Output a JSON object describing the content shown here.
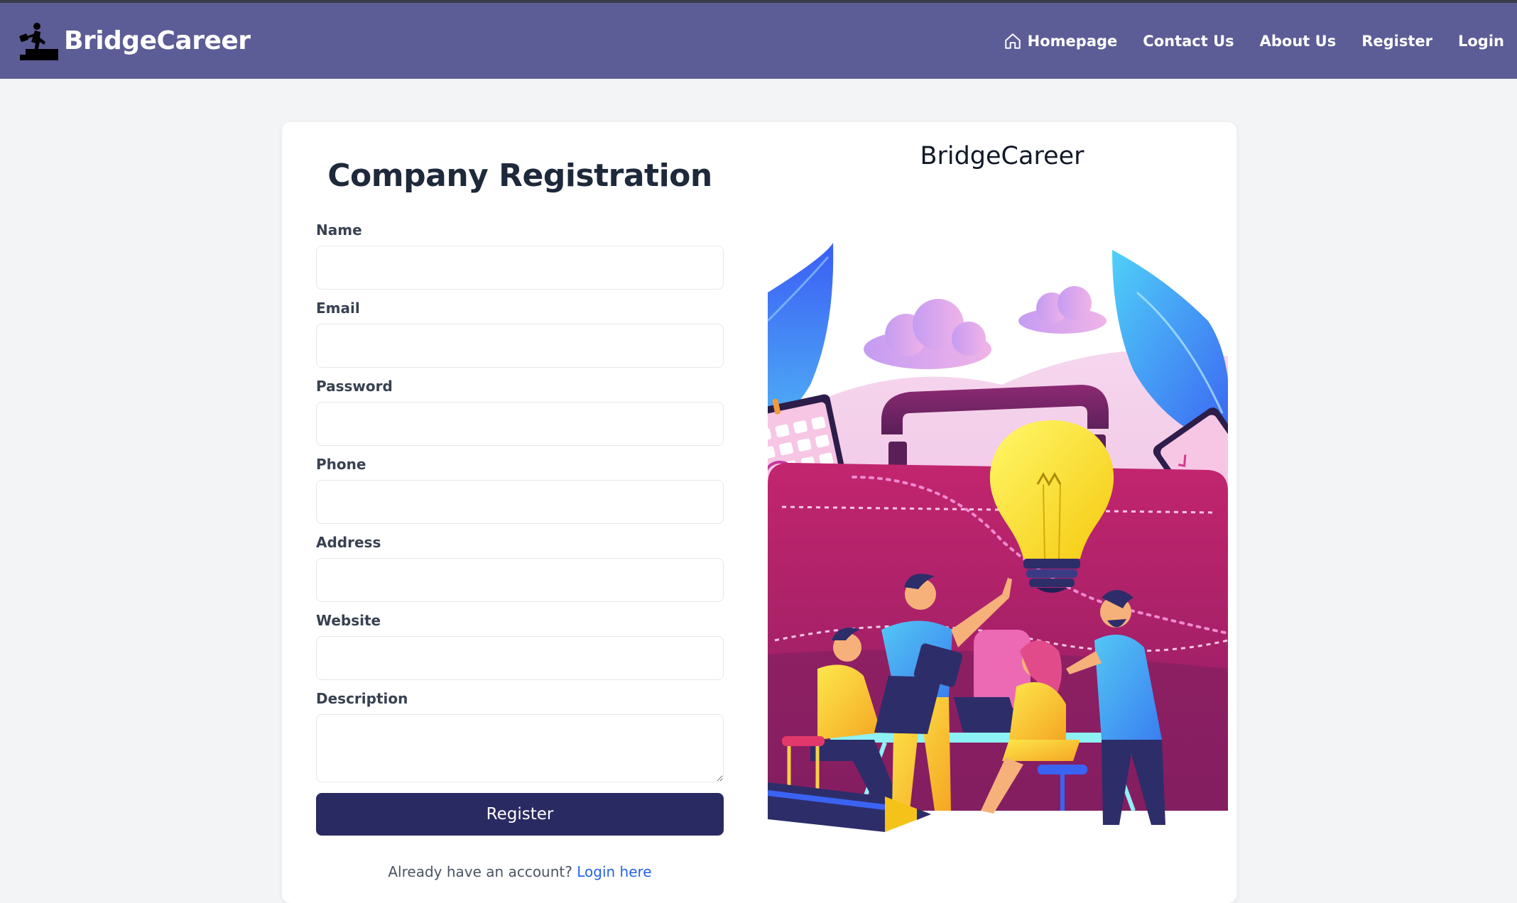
{
  "navbar": {
    "brand": "BridgeCareer",
    "links": [
      {
        "label": "Homepage",
        "icon": "home-icon"
      },
      {
        "label": "Contact Us"
      },
      {
        "label": "About Us"
      },
      {
        "label": "Register"
      },
      {
        "label": "Login"
      }
    ]
  },
  "form": {
    "title": "Company Registration",
    "fields": [
      {
        "label": "Name",
        "value": "",
        "placeholder": ""
      },
      {
        "label": "Email",
        "value": "",
        "placeholder": ""
      },
      {
        "label": "Password",
        "value": "",
        "placeholder": ""
      },
      {
        "label": "Phone",
        "value": "",
        "placeholder": ""
      },
      {
        "label": "Address",
        "value": "",
        "placeholder": ""
      },
      {
        "label": "Website",
        "value": "",
        "placeholder": ""
      },
      {
        "label": "Description",
        "value": "",
        "placeholder": ""
      }
    ],
    "submit_label": "Register",
    "login_prompt": "Already have an account?",
    "login_link": "Login here"
  },
  "illustration": {
    "title": "BridgeCareer",
    "subject": "team-brainstorm-lightbulb-illustration"
  },
  "colors": {
    "navbar": "#5c5c96",
    "button": "#2a2a62",
    "link": "#2563eb",
    "page_bg": "#f3f4f6"
  }
}
